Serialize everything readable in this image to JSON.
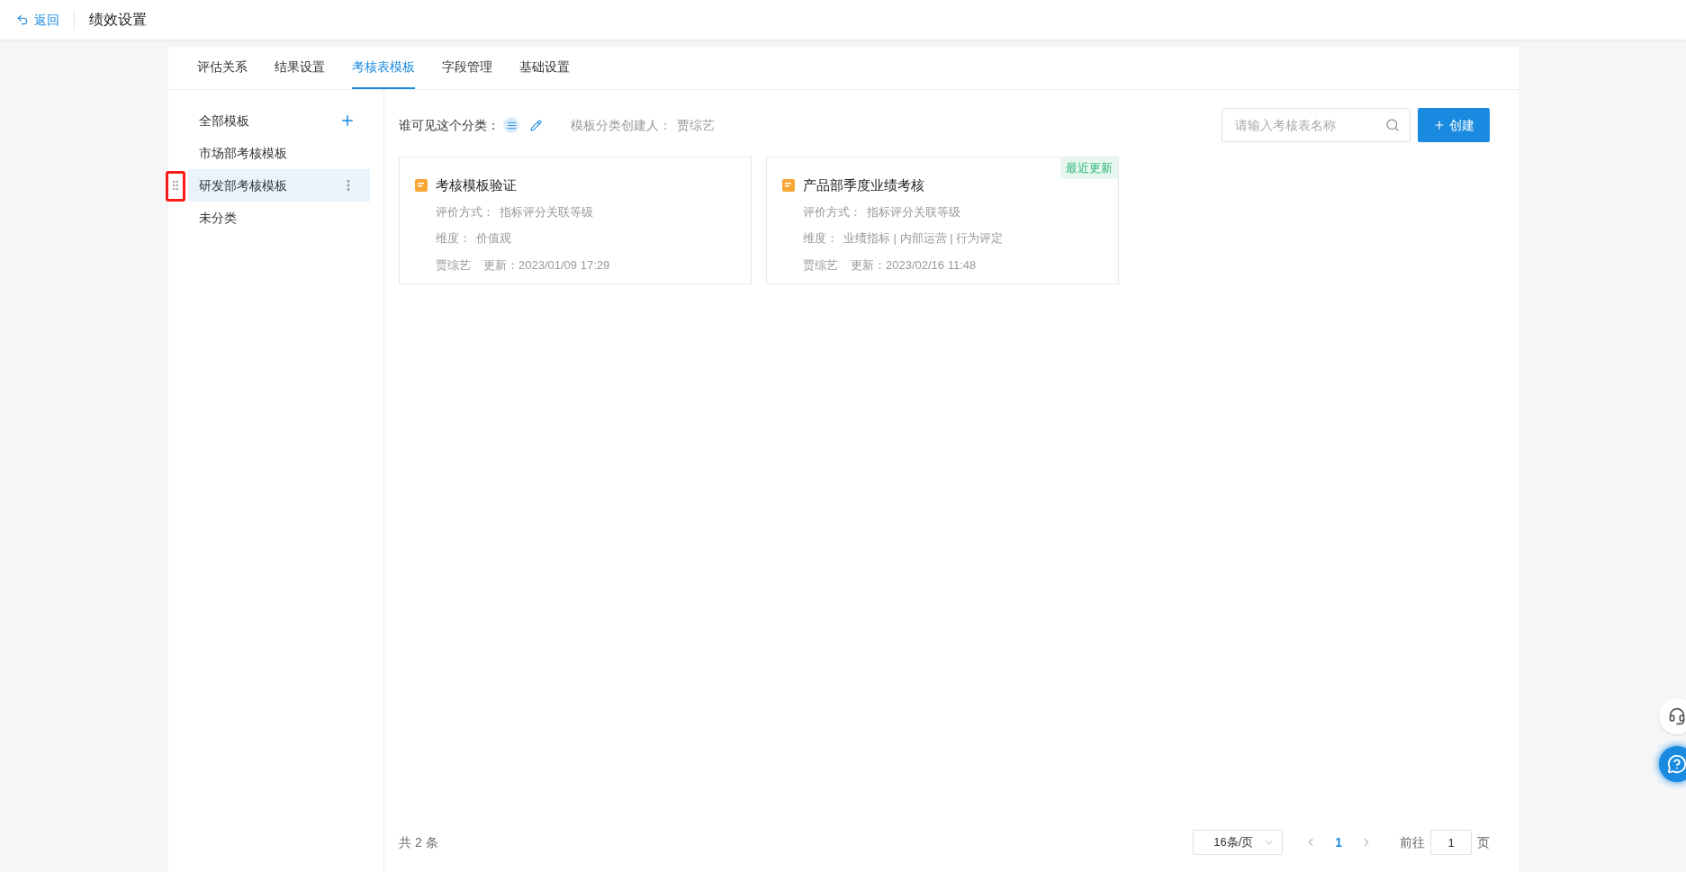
{
  "header": {
    "back_label": "返回",
    "title": "绩效设置"
  },
  "tabs": [
    {
      "label": "评估关系",
      "selected": false
    },
    {
      "label": "结果设置",
      "selected": false
    },
    {
      "label": "考核表模板",
      "selected": true
    },
    {
      "label": "字段管理",
      "selected": false
    },
    {
      "label": "基础设置",
      "selected": false
    }
  ],
  "sidebar": {
    "items": [
      {
        "label": "全部模板",
        "kind": "all",
        "selected": false,
        "highlighted": false
      },
      {
        "label": "市场部考核模板",
        "kind": "category",
        "selected": false,
        "highlighted": false
      },
      {
        "label": "研发部考核模板",
        "kind": "category",
        "selected": true,
        "highlighted": true
      },
      {
        "label": "未分类",
        "kind": "category",
        "selected": false,
        "highlighted": false
      }
    ]
  },
  "toolbar": {
    "visibility_label": "谁可见这个分类：",
    "creator_label": "模板分类创建人：",
    "creator": "贾综艺",
    "search": {
      "placeholder": "请输入考核表名称"
    },
    "create_button": "创建"
  },
  "cards": [
    {
      "title": "考核模板验证",
      "method_label": "评价方式：",
      "method": "指标评分关联等级",
      "dimension_label": "维度：",
      "dimension": "价值观",
      "author": "贾综艺",
      "updated": "更新：2023/01/09 17:29"
    },
    {
      "title": "产品部季度业绩考核",
      "badge": "最近更新",
      "method_label": "评价方式：",
      "method": "指标评分关联等级",
      "dimension_label": "维度：",
      "dimension": "业绩指标 | 内部运营 | 行为评定",
      "author": "贾综艺",
      "updated": "更新：2023/02/16 11:48"
    }
  ],
  "pagination": {
    "total": "共 2 条",
    "page_size": "16条/页",
    "pages": [
      {
        "label": "1",
        "selected": true
      }
    ],
    "goto_label": "前往",
    "goto_value": "1",
    "goto_suffix": "页"
  }
}
